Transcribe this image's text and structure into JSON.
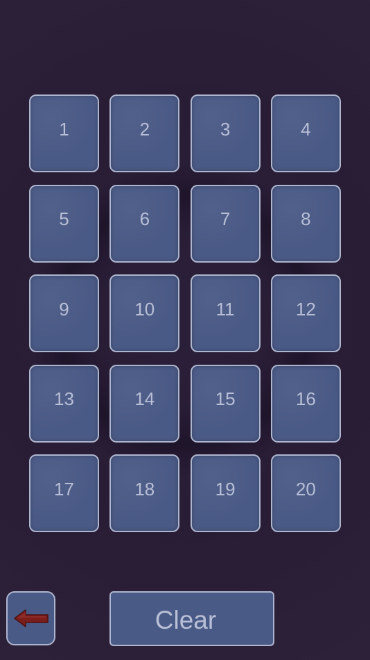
{
  "tiles": [
    {
      "label": "1"
    },
    {
      "label": "2"
    },
    {
      "label": "3"
    },
    {
      "label": "4"
    },
    {
      "label": "5"
    },
    {
      "label": "6"
    },
    {
      "label": "7"
    },
    {
      "label": "8"
    },
    {
      "label": "9"
    },
    {
      "label": "10"
    },
    {
      "label": "11"
    },
    {
      "label": "12"
    },
    {
      "label": "13"
    },
    {
      "label": "14"
    },
    {
      "label": "15"
    },
    {
      "label": "16"
    },
    {
      "label": "17"
    },
    {
      "label": "18"
    },
    {
      "label": "19"
    },
    {
      "label": "20"
    }
  ],
  "controls": {
    "back_icon": "left-arrow-icon",
    "clear_label": "Clear"
  },
  "colors": {
    "background": "#291d36",
    "tile_fill": "#4a5a86",
    "tile_border": "#aeb5cf",
    "tile_text": "#b8bfd6",
    "arrow": "#7a1e1c"
  }
}
